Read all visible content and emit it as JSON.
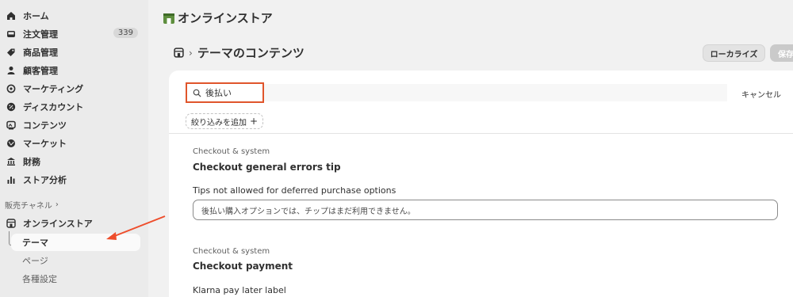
{
  "sidebar": {
    "items": [
      {
        "label": "ホーム",
        "icon": "home-icon"
      },
      {
        "label": "注文管理",
        "icon": "inbox-icon",
        "badge": "339"
      },
      {
        "label": "商品管理",
        "icon": "tag-icon"
      },
      {
        "label": "顧客管理",
        "icon": "person-icon"
      },
      {
        "label": "マーケティング",
        "icon": "target-icon"
      },
      {
        "label": "ディスカウント",
        "icon": "discount-icon"
      },
      {
        "label": "コンテンツ",
        "icon": "content-icon"
      },
      {
        "label": "マーケット",
        "icon": "globe-icon"
      },
      {
        "label": "財務",
        "icon": "bank-icon"
      },
      {
        "label": "ストア分析",
        "icon": "chart-icon"
      }
    ],
    "sales_channel_label": "販売チャネル",
    "online_store": {
      "label": "オンラインストア",
      "icon": "store-icon"
    },
    "sub_items": [
      "テーマ",
      "ページ",
      "各種設定"
    ]
  },
  "header": {
    "store_title": "オンラインストア"
  },
  "page": {
    "breadcrumb_title": "テーマのコンテンツ",
    "localize_button": "ローカライズ",
    "save_button": "保存"
  },
  "search": {
    "query": "後払い",
    "cancel_label": "キャンセル",
    "filter_label": "絞り込みを追加",
    "filter_plus": "+"
  },
  "entries": [
    {
      "category": "Checkout & system",
      "title": "Checkout general errors tip",
      "field_label": "Tips not allowed for deferred purchase options",
      "field_value": "後払い購入オプションでは、チップはまだ利用できません。"
    },
    {
      "category": "Checkout & system",
      "title": "Checkout payment",
      "field_label": "Klarna pay later label"
    }
  ],
  "colors": {
    "highlight": "#e0552b",
    "annotation_arrow": "#ee4d2b",
    "logo_green": "#5e8e3e"
  }
}
